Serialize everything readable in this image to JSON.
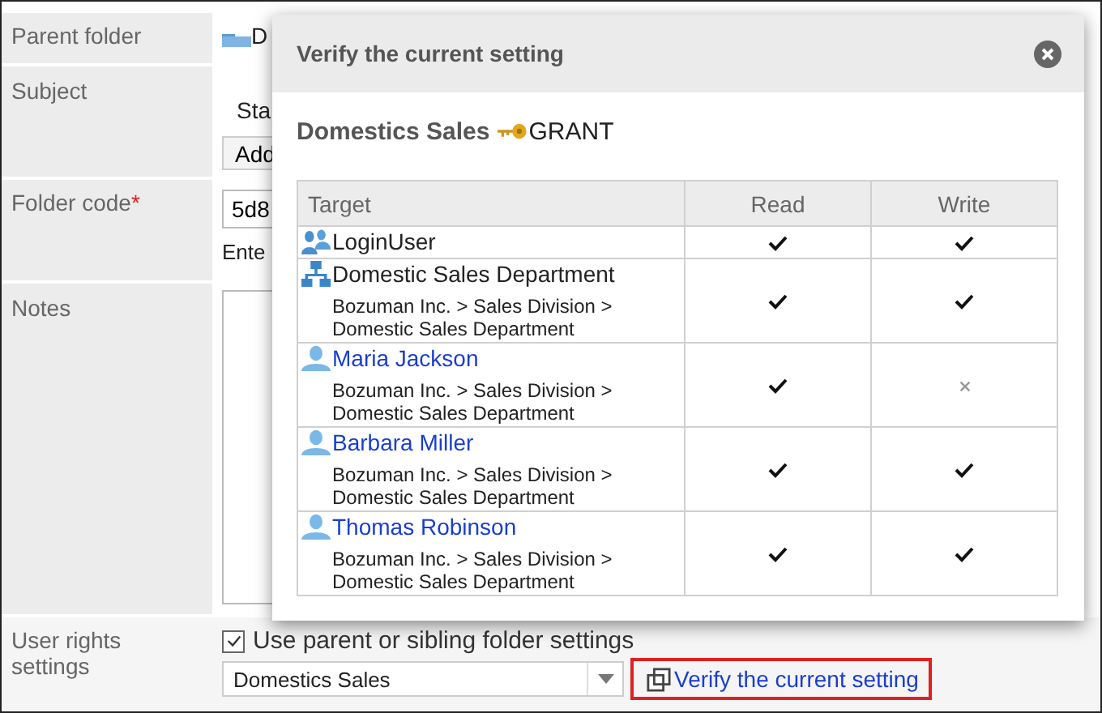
{
  "form": {
    "rows": [
      {
        "kind": "folder",
        "label": "Parent folder",
        "text": "D"
      },
      {
        "kind": "subject",
        "label": "Subject",
        "text": "Sta",
        "button": "Add"
      },
      {
        "kind": "code",
        "label": "Folder code",
        "required_mark": "*",
        "value": "5d8",
        "hint": "Ente"
      },
      {
        "kind": "notes",
        "label": "Notes"
      },
      {
        "kind": "rights",
        "label": "User rights settings",
        "checkbox": {
          "label": "Use parent or sibling folder settings",
          "checked": true
        },
        "select": "Domestics Sales",
        "link": "Verify the current setting"
      }
    ]
  },
  "dialog": {
    "title": "Verify the current setting",
    "heading": "Domestics Sales",
    "access": "GRANT",
    "columns": [
      "Target",
      "Read",
      "Write"
    ],
    "rows": [
      {
        "kind": "group",
        "name": "LoginUser",
        "read": true,
        "write": true
      },
      {
        "kind": "org",
        "name": "Domestic Sales Department",
        "path": "Bozuman Inc. > Sales Division > Domestic Sales Department",
        "read": true,
        "write": true
      },
      {
        "kind": "user",
        "name": "Maria Jackson",
        "path": "Bozuman Inc. > Sales Division > Domestic Sales Department",
        "read": true,
        "write": false
      },
      {
        "kind": "user",
        "name": "Barbara Miller",
        "path": "Bozuman Inc. > Sales Division > Domestic Sales Department",
        "read": true,
        "write": true
      },
      {
        "kind": "user",
        "name": "Thomas Robinson",
        "path": "Bozuman Inc. > Sales Division > Domestic Sales Department",
        "read": true,
        "write": true
      }
    ]
  }
}
